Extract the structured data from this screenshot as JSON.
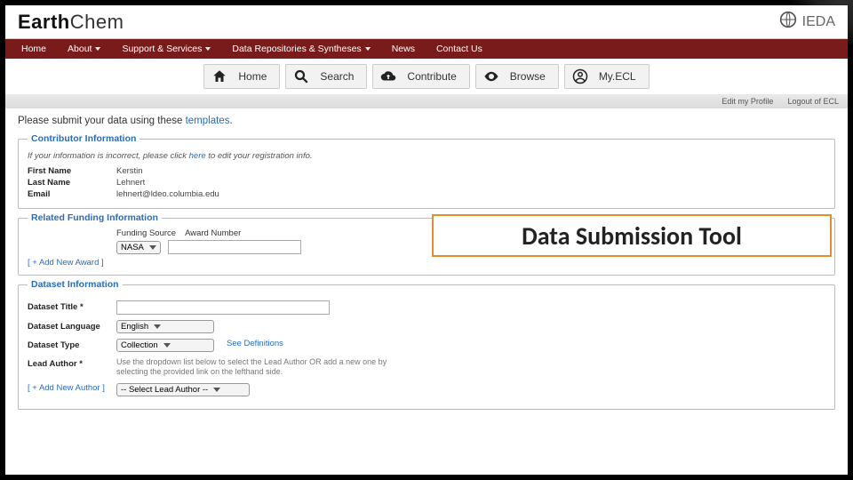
{
  "brand": {
    "prefix": "Earth",
    "suffix": "Chem",
    "org": "IEDA"
  },
  "nav": {
    "home": "Home",
    "about": "About",
    "support": "Support & Services",
    "repos": "Data Repositories & Syntheses",
    "news": "News",
    "contact": "Contact Us"
  },
  "iconnav": {
    "home": "Home",
    "search": "Search",
    "contribute": "Contribute",
    "browse": "Browse",
    "myecl": "My.ECL"
  },
  "util": {
    "editprofile": "Edit my Profile",
    "logout": "Logout of ECL"
  },
  "intro": {
    "pre": "Please submit your data using these ",
    "link": "templates",
    "post": "."
  },
  "contrib": {
    "legend": "Contributor Information",
    "note_pre": "If your information is incorrect, please click ",
    "note_link": "here",
    "note_post": " to edit your registration info.",
    "first_l": "First Name",
    "first_v": "Kerstin",
    "last_l": "Last Name",
    "last_v": "Lehnert",
    "email_l": "Email",
    "email_v": "lehnert@ldeo.columbia.edu"
  },
  "funding": {
    "legend": "Related Funding Information",
    "src_l": "Funding Source",
    "award_l": "Award Number",
    "src_val": "NASA",
    "addlink": "[ + Add New Award ]"
  },
  "dataset": {
    "legend": "Dataset Information",
    "title_l": "Dataset Title *",
    "lang_l": "Dataset Language",
    "lang_val": "English",
    "type_l": "Dataset Type",
    "type_val": "Collection",
    "seedef": "See Definitions",
    "lead_l": "Lead Author *",
    "lead_help": "Use the dropdown list below to select the Lead Author OR add a new one by selecting the provided link on the lefthand side.",
    "addauthor": "[ + Add New Author ]",
    "leadselect": "-- Select Lead Author --"
  },
  "callout": "Data Submission Tool"
}
